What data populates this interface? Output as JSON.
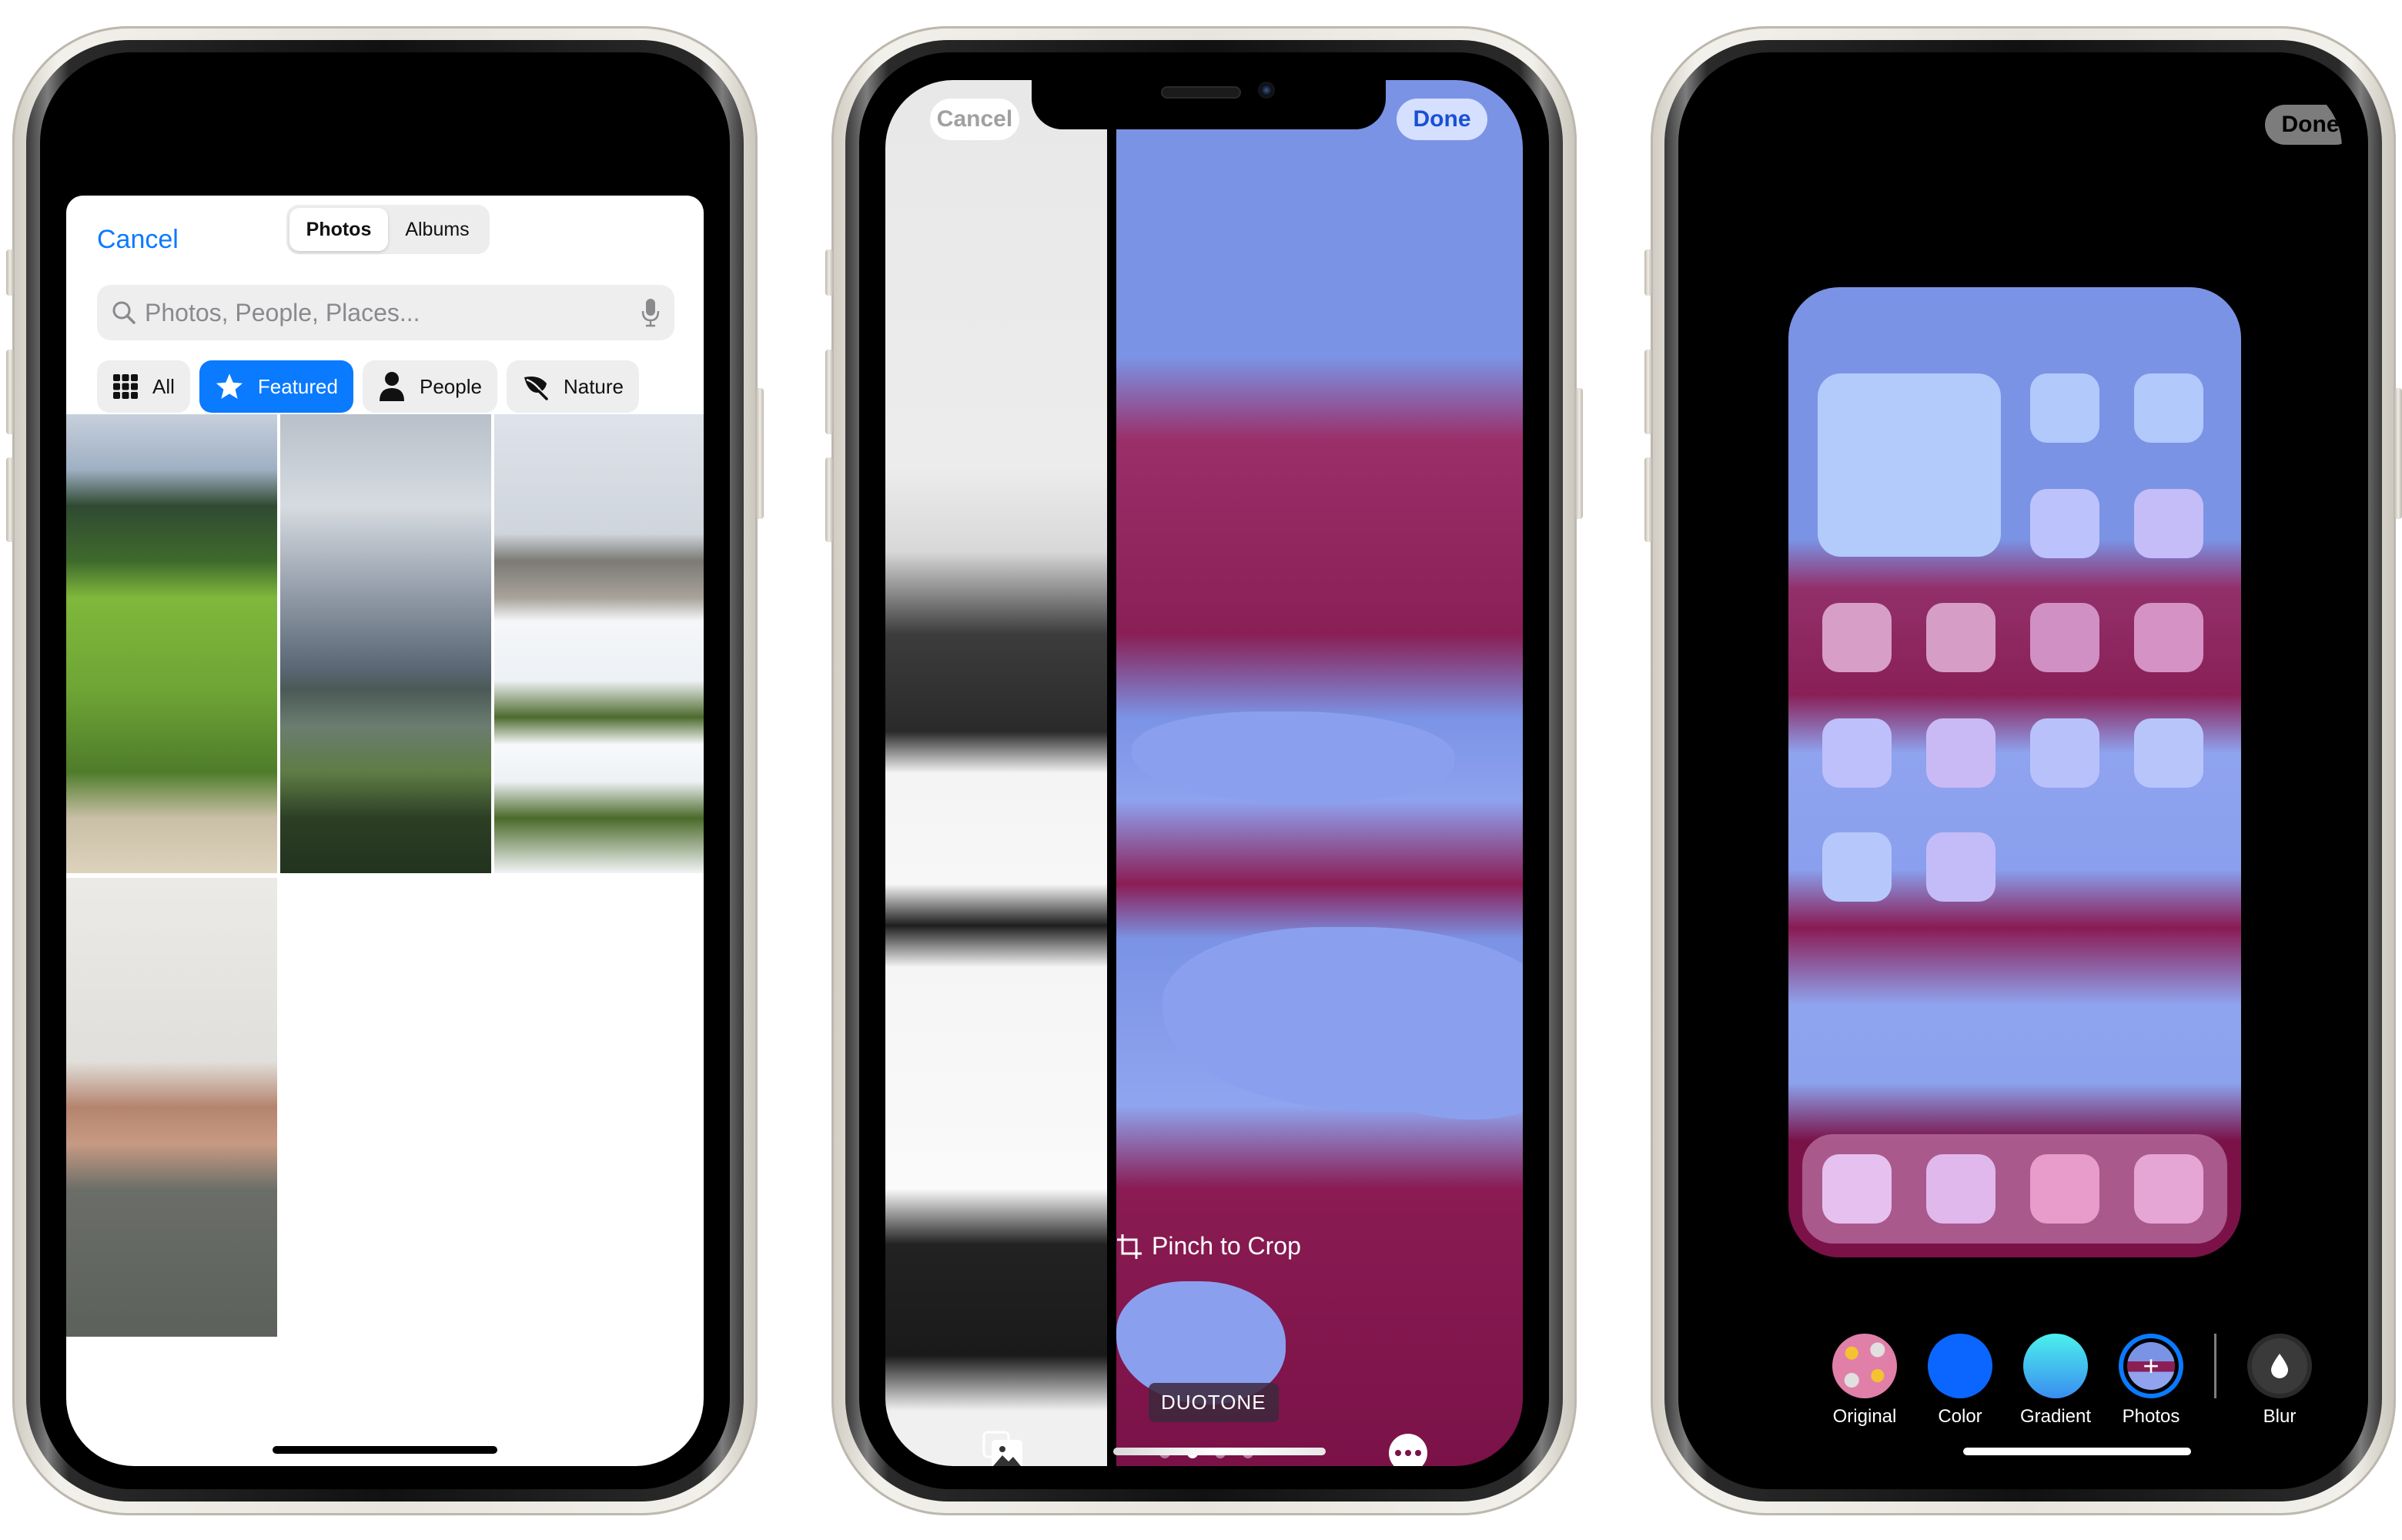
{
  "phone1": {
    "cancel_label": "Cancel",
    "segments": [
      {
        "label": "Photos",
        "active": true
      },
      {
        "label": "Albums",
        "active": false
      }
    ],
    "search": {
      "placeholder": "Photos, People, Places...",
      "icon": "search-icon",
      "mic_icon": "microphone-icon"
    },
    "filters": [
      {
        "label": "All",
        "icon": "grid-icon",
        "active": false
      },
      {
        "label": "Featured",
        "icon": "star-icon",
        "active": true
      },
      {
        "label": "People",
        "icon": "person-icon",
        "active": false
      },
      {
        "label": "Nature",
        "icon": "leaf-icon",
        "active": false
      }
    ],
    "photos": [
      {
        "subject": "green meadow with pine trees"
      },
      {
        "subject": "cloudy sky over valley and mountain"
      },
      {
        "subject": "snowy yard with tree and snowman"
      },
      {
        "subject": "smiling man in grey t-shirt"
      }
    ]
  },
  "phone2": {
    "cancel_label": "Cancel",
    "done_label": "Done",
    "hint_label": "Pinch to Crop",
    "filter_label": "DUOTONE",
    "page_dots": {
      "count": 4,
      "active_index": 1
    },
    "colors": {
      "duotone_light": "#7b93e5",
      "duotone_dark": "#7a1248",
      "done_text": "#1a4fd6"
    }
  },
  "phone3": {
    "done_label": "Done",
    "options": [
      {
        "label": "Original",
        "icon": "emoji-pattern-icon"
      },
      {
        "label": "Color",
        "icon": "color-swatch-icon",
        "color": "#0a66ff"
      },
      {
        "label": "Gradient",
        "icon": "gradient-swatch-icon"
      },
      {
        "label": "Photos",
        "icon": "add-photo-icon",
        "selected": true
      },
      {
        "label": "Blur",
        "icon": "blur-drop-icon"
      }
    ]
  }
}
